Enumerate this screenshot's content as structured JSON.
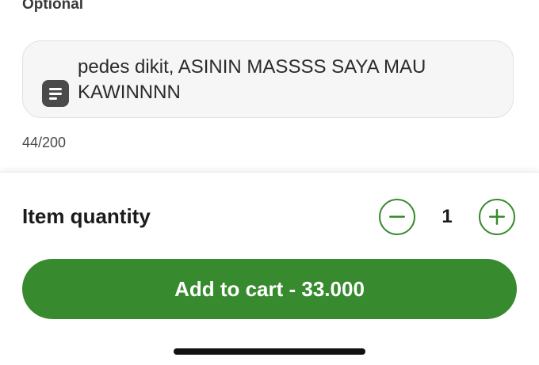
{
  "notes": {
    "section_label": "Optional",
    "text": "pedes dikit, ASININ MASSSS SAYA MAU KAWINNNN",
    "icon": "note-icon",
    "char_count": "44/200"
  },
  "quantity": {
    "label": "Item quantity",
    "value": "1",
    "minus_icon": "minus-icon",
    "plus_icon": "plus-icon"
  },
  "cart": {
    "button_label": "Add to cart - 33.000"
  },
  "colors": {
    "accent": "#388a2e",
    "text": "#1b1b1b",
    "input_bg": "#f6f6f6"
  }
}
